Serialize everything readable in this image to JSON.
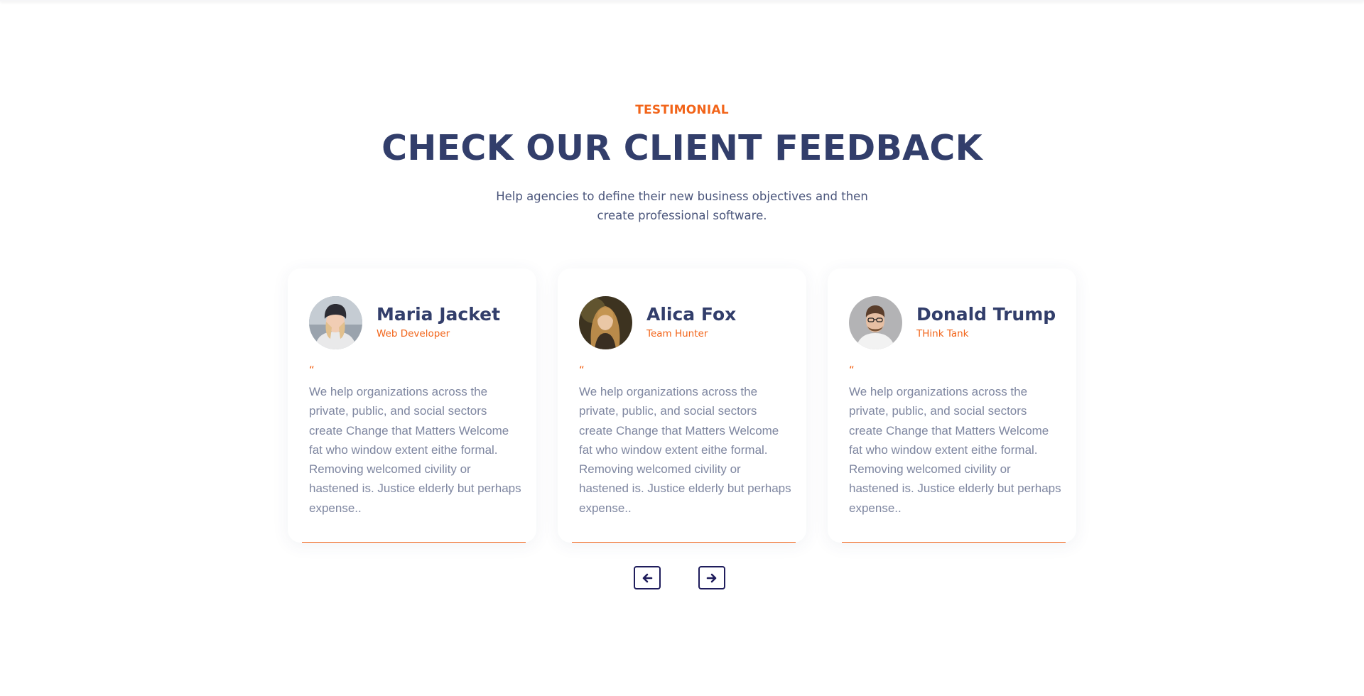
{
  "section": {
    "eyebrow": "TESTIMONIAL",
    "title": "CHECK OUR CLIENT FEEDBACK",
    "subtitle": "Help agencies to define their new business objectives and then create professional software."
  },
  "testimonials": [
    {
      "name": "Maria Jacket",
      "role": "Web Developer",
      "quote_mark": "“",
      "quote": "We help organizations across the private, public, and social sectors create Change that Matters Welcome fat who window extent eithe formal. Removing welcomed civility or hastened is. Justice elderly but perhaps expense..",
      "avatar_icon": "person-avatar-icon"
    },
    {
      "name": "Alica Fox",
      "role": "Team Hunter",
      "quote_mark": "“",
      "quote": "We help organizations across the private, public, and social sectors create Change that Matters Welcome fat who window extent eithe formal. Removing welcomed civility or hastened is. Justice elderly but perhaps expense..",
      "avatar_icon": "person-avatar-icon"
    },
    {
      "name": "Donald Trump",
      "role": "THink Tank",
      "quote_mark": "“",
      "quote": "We help organizations across the private, public, and social sectors create Change that Matters Welcome fat who window extent eithe formal. Removing welcomed civility or hastened is. Justice elderly but perhaps expense..",
      "avatar_icon": "person-avatar-icon"
    }
  ],
  "navigation": {
    "prev_icon": "arrow-left-icon",
    "next_icon": "arrow-right-icon"
  },
  "colors": {
    "accent": "#f26419",
    "heading": "#323e6b",
    "body_text": "#7e86a0",
    "nav_border": "#1f1d5c"
  }
}
